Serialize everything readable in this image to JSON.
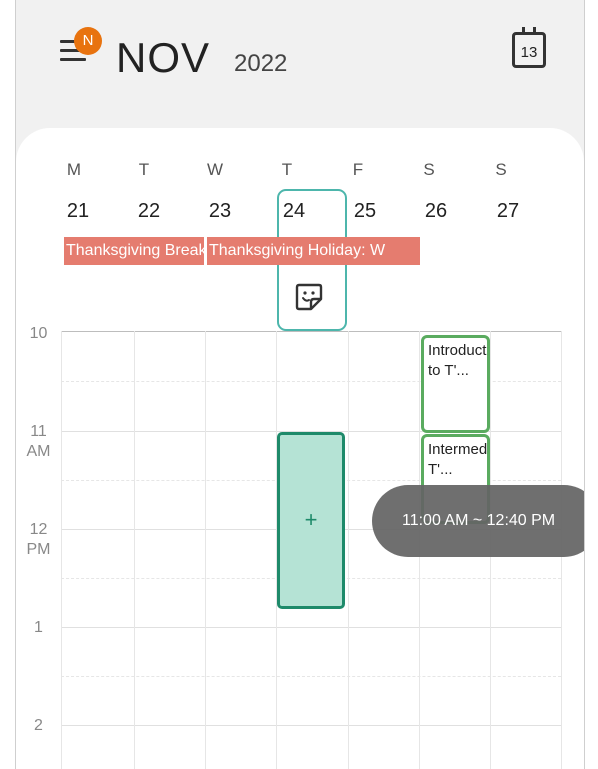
{
  "header": {
    "badge": "N",
    "month": "NOV",
    "year": "2022",
    "calendar_icon_day": "13"
  },
  "week": {
    "days": [
      {
        "dow": "M",
        "num": "21"
      },
      {
        "dow": "T",
        "num": "22"
      },
      {
        "dow": "W",
        "num": "23"
      },
      {
        "dow": "T",
        "num": "24"
      },
      {
        "dow": "F",
        "num": "25"
      },
      {
        "dow": "S",
        "num": "26"
      },
      {
        "dow": "S",
        "num": "27"
      }
    ],
    "holidays": [
      {
        "label": "Thanksgiving Break"
      },
      {
        "label": "Thanksgiving Holiday: W"
      }
    ]
  },
  "timeline": {
    "labels": [
      {
        "hour": "10",
        "ampm": ""
      },
      {
        "hour": "11",
        "ampm": "AM"
      },
      {
        "hour": "12",
        "ampm": "PM"
      },
      {
        "hour": "1",
        "ampm": ""
      },
      {
        "hour": "2",
        "ampm": ""
      }
    ]
  },
  "events": [
    {
      "title": "Introduction to T'..."
    },
    {
      "title": "Intermediate T'..."
    }
  ],
  "selection": {
    "plus": "+",
    "range": "11:00 AM ~ 12:40 PM"
  },
  "colors": {
    "holiday": "#e57c6f",
    "badge": "#e8730f",
    "selection_fill": "#b5e3d5",
    "selection_border": "#1e8a6a",
    "event_border": "#5aab5f",
    "today_outline": "#4db6ac"
  }
}
